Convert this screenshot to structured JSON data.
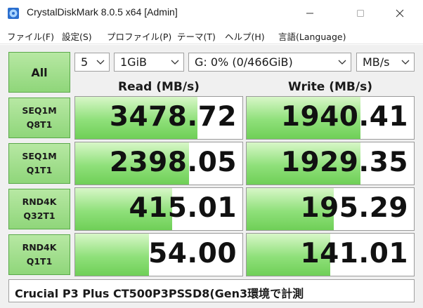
{
  "window": {
    "title": "CrystalDiskMark 8.0.5 x64 [Admin]"
  },
  "menu": [
    {
      "label": "ファイル(F)"
    },
    {
      "label": "設定(S)"
    },
    {
      "label": "プロファイル(P)"
    },
    {
      "label": "テーマ(T)"
    },
    {
      "label": "ヘルプ(H)"
    },
    {
      "label": "言語(Language)"
    }
  ],
  "controls": {
    "all_label": "All",
    "count": "5",
    "size": "1GiB",
    "drive": "G: 0% (0/466GiB)",
    "unit": "MB/s"
  },
  "headers": {
    "read": "Read (MB/s)",
    "write": "Write (MB/s)"
  },
  "rows": [
    {
      "line1": "SEQ1M",
      "line2": "Q8T1",
      "read": "3478.72",
      "write": "1940.41",
      "read_fill": 0.73,
      "write_fill": 0.68
    },
    {
      "line1": "SEQ1M",
      "line2": "Q1T1",
      "read": "2398.05",
      "write": "1929.35",
      "read_fill": 0.68,
      "write_fill": 0.68
    },
    {
      "line1": "RND4K",
      "line2": "Q32T1",
      "read": "415.01",
      "write": "195.29",
      "read_fill": 0.58,
      "write_fill": 0.52
    },
    {
      "line1": "RND4K",
      "line2": "Q1T1",
      "read": "54.00",
      "write": "141.01",
      "read_fill": 0.44,
      "write_fill": 0.5
    }
  ],
  "comment": "Crucial P3 Plus CT500P3PSSD8(Gen3環境で計測",
  "icons": {
    "app": "crystaldiskmark-disk-icon",
    "minimize": "minimize-icon",
    "maximize": "maximize-icon",
    "close": "close-icon",
    "dropdown": "chevron-down-icon"
  },
  "colors": {
    "button_green": "#9edc86",
    "bar_green": "#8fe07a",
    "panel_bg": "#f0f0f0"
  }
}
